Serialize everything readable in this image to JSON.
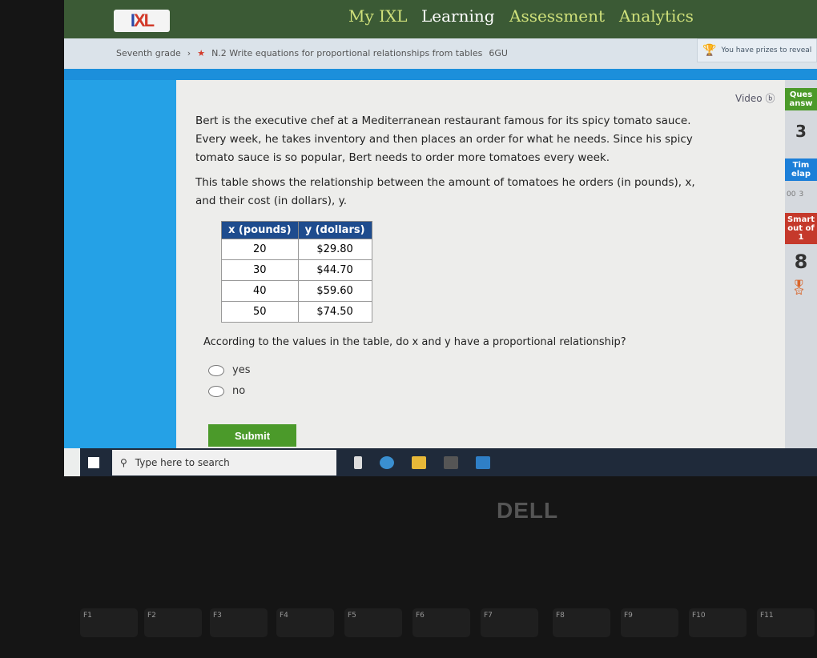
{
  "nav": {
    "logo": "IXL",
    "items": [
      "My IXL",
      "Learning",
      "Assessment",
      "Analytics"
    ],
    "active": "Learning"
  },
  "breadcrumb": {
    "grade": "Seventh grade",
    "skill": "N.2 Write equations for proportional relationships from tables",
    "code": "6GU"
  },
  "prizes": "You have prizes to reveal",
  "question": {
    "p1": "Bert is the executive chef at a Mediterranean restaurant famous for its spicy tomato sauce. Every week, he takes inventory and then places an order for what he needs. Since his spicy tomato sauce is so popular, Bert needs to order more tomatoes every week.",
    "p2": "This table shows the relationship between the amount of tomatoes he orders (in pounds), x, and their cost (in dollars), y.",
    "table": {
      "headers": [
        "x (pounds)",
        "y (dollars)"
      ],
      "rows": [
        [
          "20",
          "$29.80"
        ],
        [
          "30",
          "$44.70"
        ],
        [
          "40",
          "$59.60"
        ],
        [
          "50",
          "$74.50"
        ]
      ]
    },
    "ask": "According to the values in the table, do x and y have a proportional relationship?",
    "options": [
      "yes",
      "no"
    ],
    "submit": "Submit"
  },
  "sidebar": {
    "video": "Video",
    "questions_label": "Ques answ",
    "questions_value": "3",
    "time_label": "Tim elap",
    "time_hr": "00",
    "time_min": "3",
    "smartscore_label": "Smart out of 1",
    "smartscore_value": "8"
  },
  "taskbar": {
    "search_placeholder": "Type here to search"
  },
  "laptop": {
    "brand": "DELL",
    "keys": [
      "F1",
      "F2",
      "F3",
      "F4",
      "F5",
      "F6",
      "F7",
      "F8",
      "F9",
      "F10",
      "F11"
    ]
  },
  "colors": {
    "nav": "#3b5a35",
    "accent_blue": "#1c8fdb",
    "submit": "#4b9a2a",
    "table_header": "#1e4c8e"
  }
}
